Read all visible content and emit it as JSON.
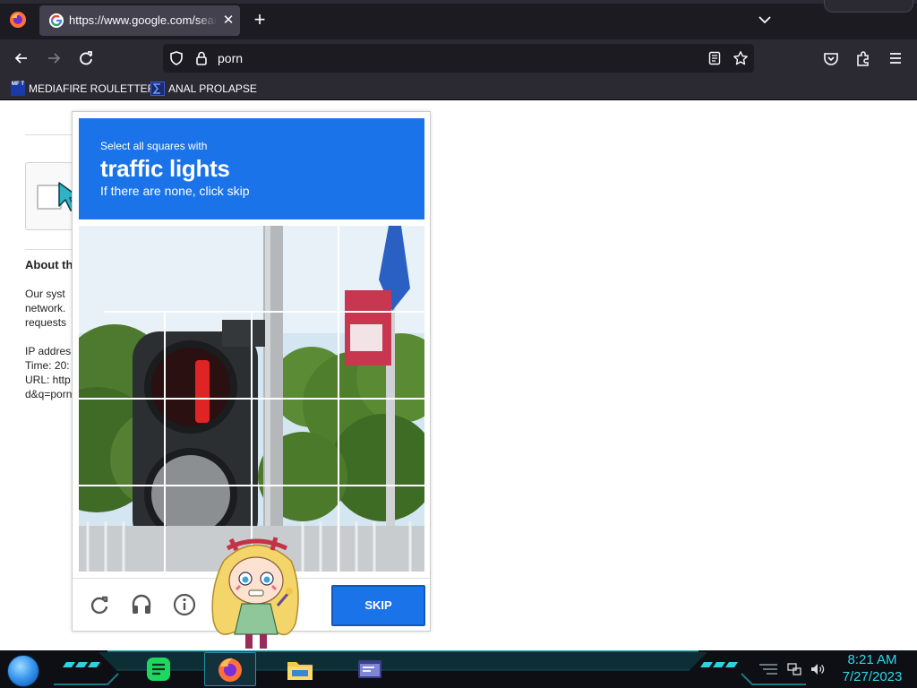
{
  "browser": {
    "tab_title": "https://www.google.com/search?q=porn",
    "address": "porn",
    "bookmarks": [
      "MEDIAFIRE ROULETTER",
      "ANAL PROLAPSE"
    ],
    "bookmark_icon_text": "MF T"
  },
  "page": {
    "about_title": "About th",
    "para_lines": [
      "Our syst",
      "network.",
      "requests"
    ],
    "info_lines": [
      "IP addres",
      "Time: 20:",
      "URL: http",
      "d&q=porn"
    ]
  },
  "captcha": {
    "instruction_small": "Select all squares with",
    "instruction_target": "traffic lights",
    "instruction_sub": "If there are none, click skip",
    "skip_label": "SKIP",
    "grid_rows": 4,
    "grid_cols": 4
  },
  "taskbar": {
    "time": "8:21 AM",
    "date": "7/27/2023",
    "apps": [
      "notes-app-icon",
      "firefox-icon",
      "file-explorer-icon",
      "window-app-icon"
    ]
  },
  "colors": {
    "captcha_blue": "#1a73e8",
    "browser_dark": "#2b2a33",
    "clock_cyan": "#33d6e8"
  }
}
